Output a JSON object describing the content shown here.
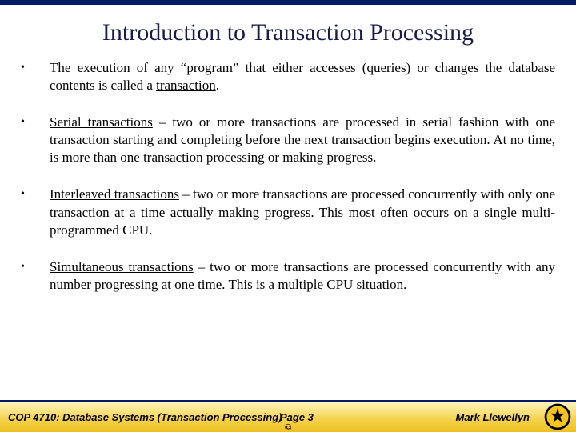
{
  "title": "Introduction to Transaction Processing",
  "bullets": [
    {
      "pre": "The execution of any “program” that either accesses (queries) or changes the database contents is called a ",
      "term": "transaction",
      "post": "."
    },
    {
      "pre": "",
      "term": "Serial transactions",
      "post": " – two or more transactions are processed in serial fashion with one transaction starting and completing before the next transaction begins execution.  At no time, is more than one transaction processing or making progress."
    },
    {
      "pre": "",
      "term": "Interleaved transactions",
      "post": " – two or more transactions are processed concurrently with only one transaction at a time actually making progress.  This most often occurs on a single multi-programmed CPU."
    },
    {
      "pre": "",
      "term": "Simultaneous transactions",
      "post": " – two or more transactions are processed concurrently with any number progressing at one time.  This is a multiple CPU situation."
    }
  ],
  "footer": {
    "course": "COP 4710: Database Systems  (Transaction Processing)",
    "page": "Page 3",
    "author": "Mark Llewellyn",
    "copyright": "©"
  }
}
